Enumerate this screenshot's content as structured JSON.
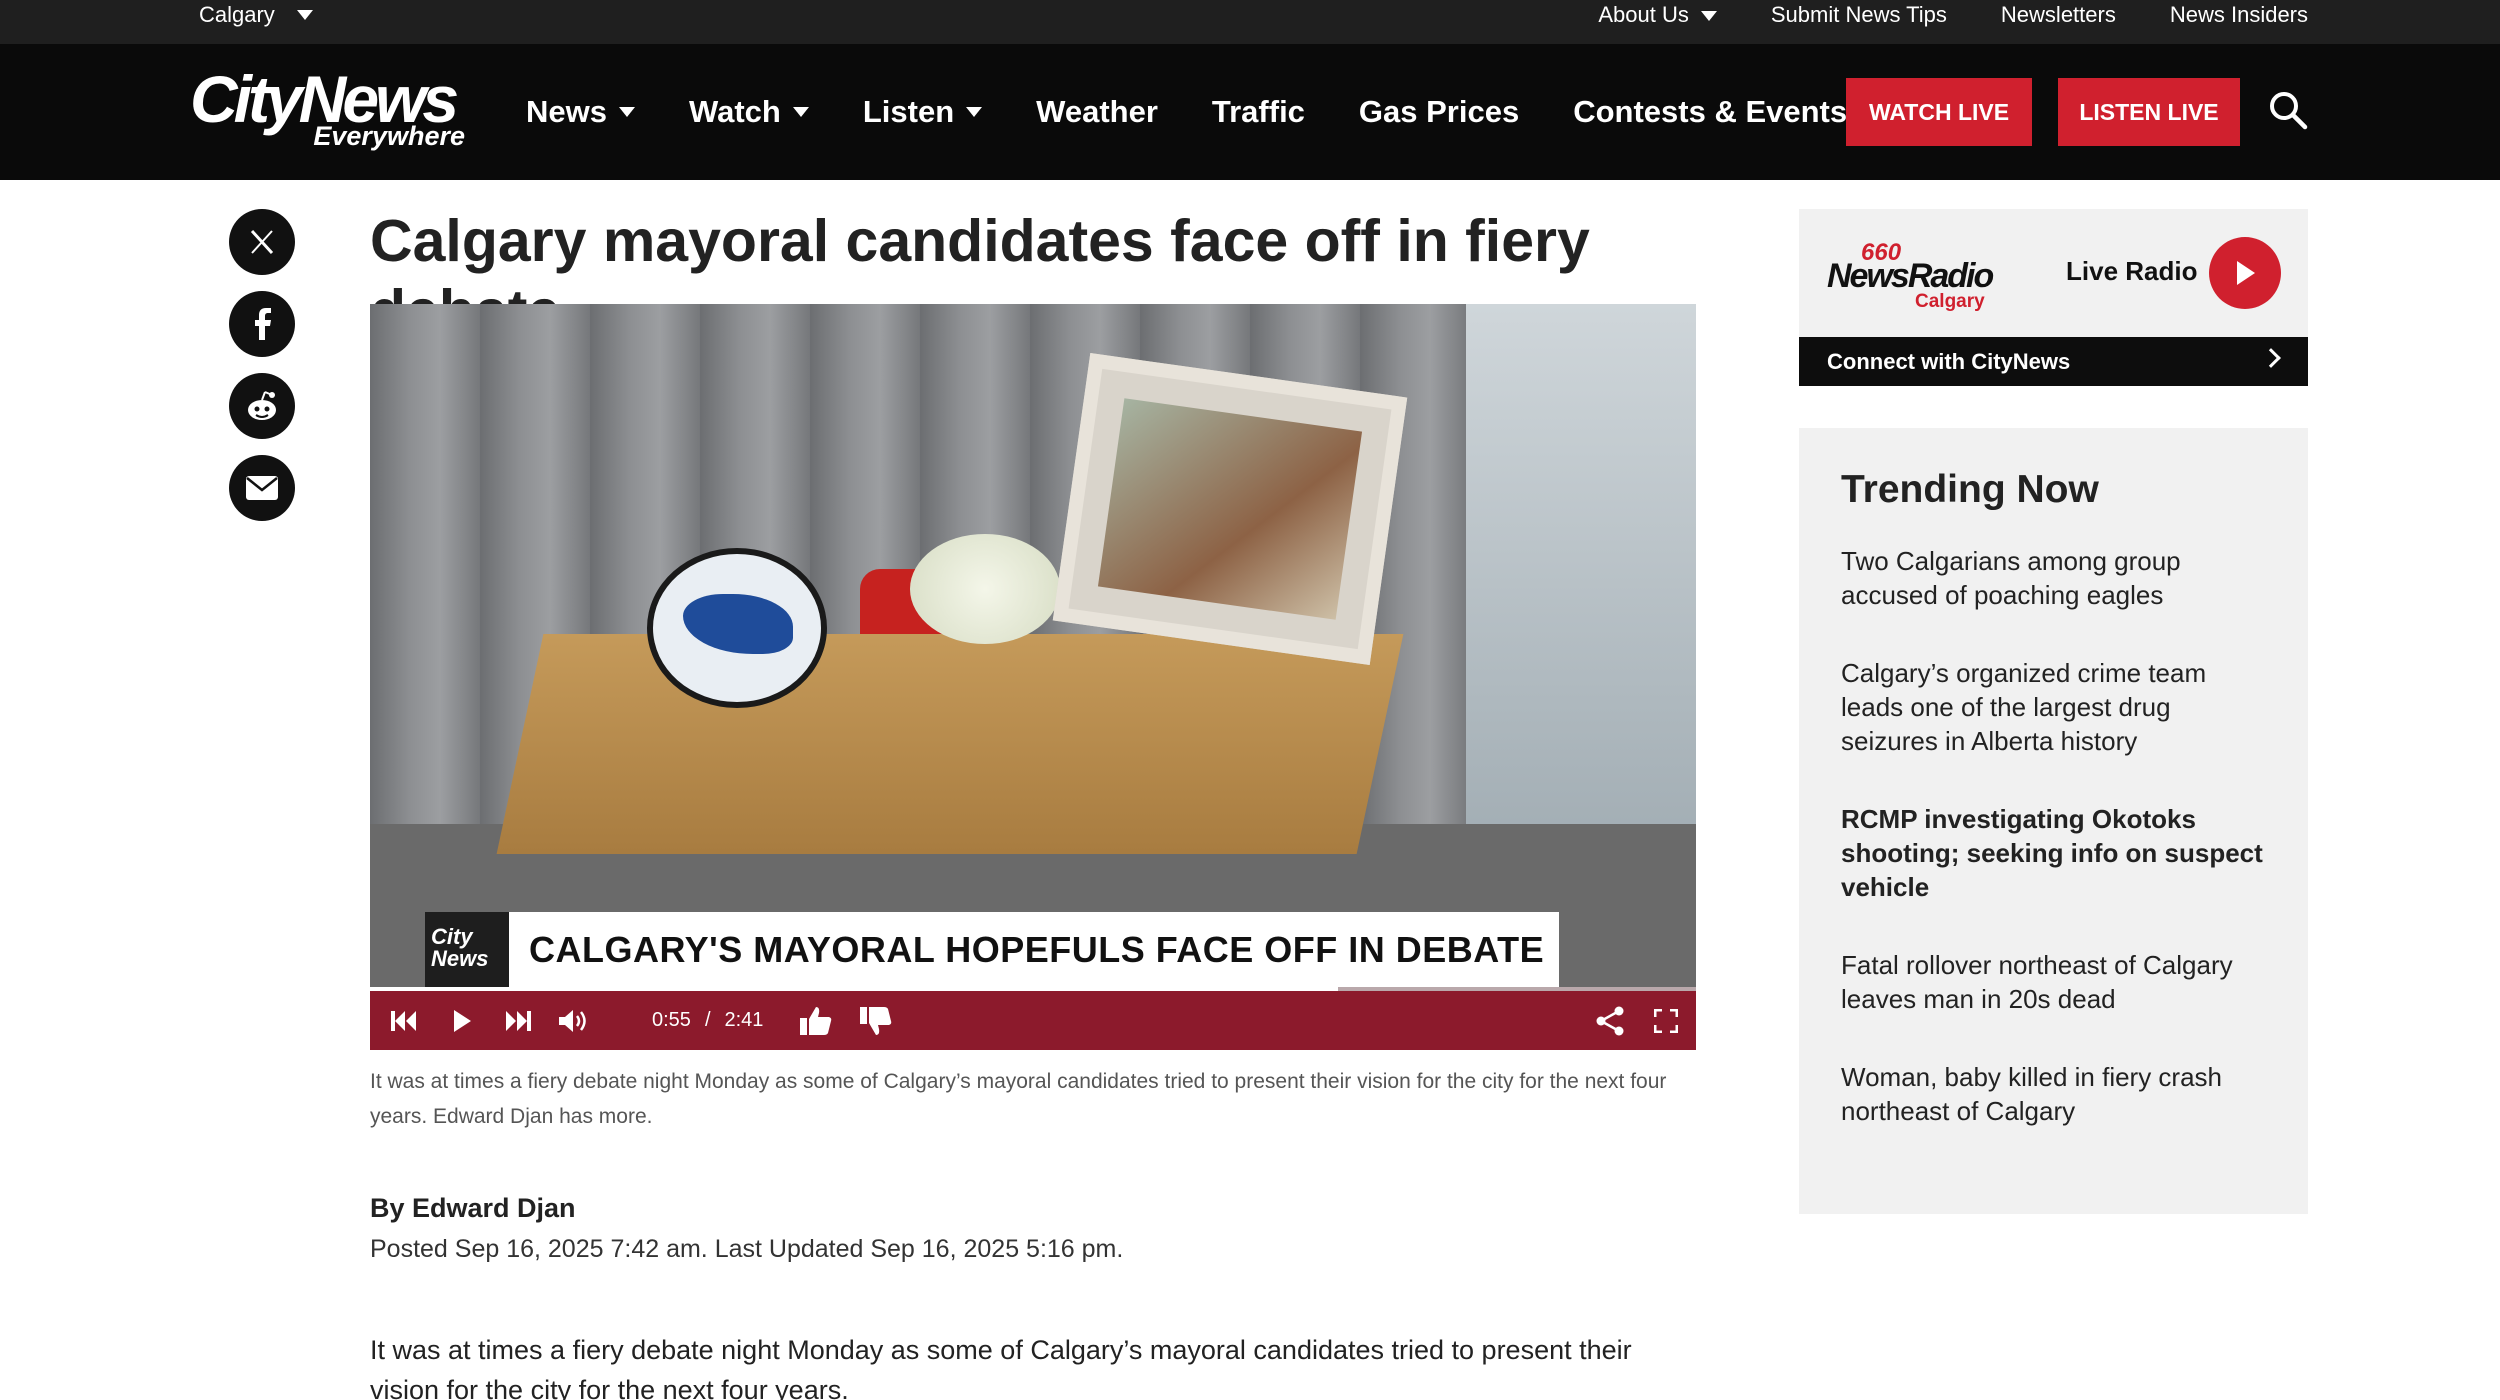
{
  "topbar": {
    "city": "Calgary",
    "links": [
      "About Us",
      "Submit News Tips",
      "Newsletters",
      "News Insiders"
    ]
  },
  "logo": {
    "line1": "CityNews",
    "line2": "Everywhere"
  },
  "nav": {
    "items": [
      {
        "label": "News",
        "dropdown": true
      },
      {
        "label": "Watch",
        "dropdown": true
      },
      {
        "label": "Listen",
        "dropdown": true
      },
      {
        "label": "Weather",
        "dropdown": false
      },
      {
        "label": "Traffic",
        "dropdown": false
      },
      {
        "label": "Gas Prices",
        "dropdown": false
      },
      {
        "label": "Contests & Events",
        "dropdown": true
      }
    ],
    "watch_live": "WATCH LIVE",
    "listen_live": "LISTEN LIVE"
  },
  "share": {
    "icons": [
      "x-icon",
      "facebook-icon",
      "reddit-icon",
      "email-icon"
    ]
  },
  "article": {
    "headline": "Calgary mayoral candidates face off in fiery debate",
    "video": {
      "lower_third_logo_1": "City",
      "lower_third_logo_2": "News",
      "lower_third": "CALGARY'S MAYORAL HOPEFULS FACE OFF IN DEBATE",
      "current_time": "0:55",
      "separator": "/",
      "duration": "2:41",
      "progress": 0.73
    },
    "caption": "It was at times a fiery debate night Monday as some of Calgary’s mayoral candidates tried to present their vision for the city for the next four years. Edward Djan has more.",
    "byline": "By Edward Djan",
    "posted": "Posted Sep 16, 2025 7:42 am.  Last Updated Sep 16, 2025 5:16 pm.",
    "body": "It was at times a fiery debate night Monday as some of Calgary’s mayoral candidates tried to present their vision for the city for the next four years."
  },
  "sidebar": {
    "radio": {
      "freq": "660",
      "brand": "NewsRadio",
      "city": "Calgary",
      "label": "Live Radio"
    },
    "connect": "Connect with CityNews",
    "trending_title": "Trending Now",
    "trending": [
      {
        "title": "Two Calgarians among group accused of poaching eagles",
        "bold": false
      },
      {
        "title": "Calgary’s organized crime team leads one of the largest drug seizures in Alberta history",
        "bold": false
      },
      {
        "title": "RCMP investigating Okotoks shooting; seeking info on suspect vehicle",
        "bold": true
      },
      {
        "title": "Fatal rollover northeast of Calgary leaves man in 20s dead",
        "bold": false
      },
      {
        "title": "Woman, baby killed in fiery crash northeast of Calgary",
        "bold": false
      }
    ]
  },
  "colors": {
    "brand_red": "#d0202e",
    "player_bar": "#8c1a2c",
    "nav_bg": "#0a0a0a"
  }
}
